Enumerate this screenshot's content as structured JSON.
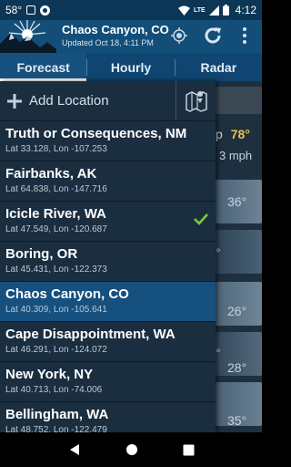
{
  "status": {
    "temp": "58°",
    "lte": "LTE",
    "time": "4:12"
  },
  "app": {
    "title": "Chaos Canyon, CO",
    "updated": "Updated Oct 18, 4:11 PM"
  },
  "tabs": [
    {
      "label": "Forecast"
    },
    {
      "label": "Hourly"
    },
    {
      "label": "Radar"
    }
  ],
  "drawer": {
    "add_label": "Add Location",
    "locations": [
      {
        "name": "Truth or Consequences, NM",
        "coords": "Lat 33.128, Lon -107.253"
      },
      {
        "name": "Fairbanks, AK",
        "coords": "Lat 64.838, Lon -147.716"
      },
      {
        "name": "Icicle River, WA",
        "coords": "Lat 47.549, Lon -120.687",
        "checked": true
      },
      {
        "name": "Boring, OR",
        "coords": "Lat 45.431, Lon -122.373"
      },
      {
        "name": "Chaos Canyon, CO",
        "coords": "Lat 40.309, Lon -105.641",
        "selected": true
      },
      {
        "name": "Cape Disappointment, WA",
        "coords": "Lat 46.291, Lon -124.072"
      },
      {
        "name": "New York, NY",
        "coords": "Lat 40.713, Lon -74.006"
      },
      {
        "name": "Bellingham, WA",
        "coords": "Lat 48.752, Lon -122.479"
      }
    ]
  },
  "background": {
    "temp_p": "p",
    "temp_hi": "78°",
    "wind": "3 mph",
    "row_temps": [
      "36°",
      "°",
      "26°",
      "°",
      "28°",
      "35°"
    ]
  },
  "colors": {
    "accent": "#16507f",
    "check": "#7cc93f",
    "highlight": "#e5c24d"
  }
}
